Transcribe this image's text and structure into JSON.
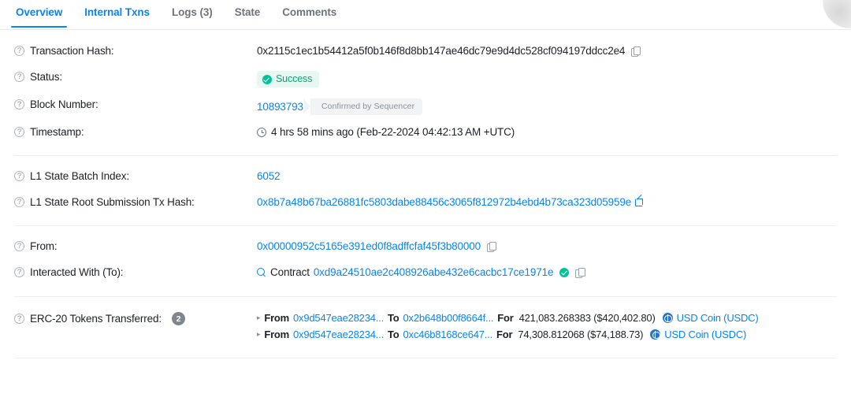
{
  "tabs": [
    {
      "label": "Overview",
      "state": "active"
    },
    {
      "label": "Internal Txns",
      "state": "blue"
    },
    {
      "label": "Logs (3)",
      "state": "muted"
    },
    {
      "label": "State",
      "state": "muted"
    },
    {
      "label": "Comments",
      "state": "muted"
    }
  ],
  "rows": {
    "tx_hash": {
      "label": "Transaction Hash:",
      "value": "0x2115c1ec1b54412a5f0b146f8d8bb147ae46dc79e9d4dc528cf094197ddcc2e4"
    },
    "status": {
      "label": "Status:",
      "value": "Success"
    },
    "block_number": {
      "label": "Block Number:",
      "value": "10893793",
      "badge": "Confirmed by Sequencer"
    },
    "timestamp": {
      "label": "Timestamp:",
      "value": "4 hrs 58 mins ago (Feb-22-2024 04:42:13 AM +UTC)"
    },
    "l1_batch_index": {
      "label": "L1 State Batch Index:",
      "value": "6052"
    },
    "l1_root_tx_hash": {
      "label": "L1 State Root Submission Tx Hash:",
      "value": "0x8b7a48b67ba26881fc5803dabe88456c3065f812972b4ebd4b73ca323d05959e"
    },
    "from": {
      "label": "From:",
      "value": "0x00000952c5165e391ed0f8adffcfaf45f3b80000"
    },
    "interacted_with": {
      "label": "Interacted With (To):",
      "prefix": "Contract",
      "value": "0xd9a24510ae2c408926abe432e6cacbc17ce1971e"
    },
    "erc20": {
      "label": "ERC-20 Tokens Transferred:",
      "count": "2",
      "from_key": "From",
      "to_key": "To",
      "for_key": "For",
      "transfers": [
        {
          "from": "0x9d547eae28234...",
          "to": "0x2b648b00f8664f...",
          "amount": "421,083.268383 ($420,402.80)",
          "token": "USD Coin (USDC)"
        },
        {
          "from": "0x9d547eae28234...",
          "to": "0xc46b8168ce647...",
          "amount": "74,308.812068 ($74,188.73)",
          "token": "USD Coin (USDC)"
        }
      ]
    }
  },
  "colors": {
    "link": "#0784f5",
    "success": "#00a878",
    "success_bg": "#e7f8f3",
    "muted": "#6c757d",
    "usdc": "#2775ca"
  }
}
